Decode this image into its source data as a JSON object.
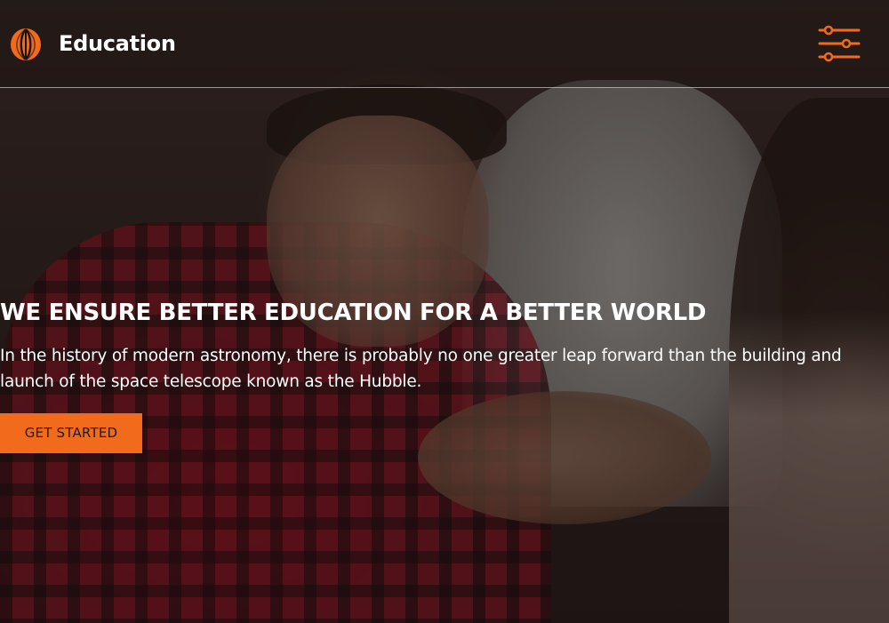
{
  "brand": {
    "name": "Education",
    "logo_icon": "flame-logo-icon",
    "accent_color": "#f26b1d"
  },
  "header": {
    "menu_icon": "sliders-menu-icon"
  },
  "hero": {
    "headline": "WE ENSURE BETTER EDUCATION FOR A BETTER WORLD",
    "description": "In the history of modern astronomy, there is probably no one greater leap forward than the building and launch of the space telescope known as the Hubble.",
    "cta_label": "GET STARTED"
  }
}
